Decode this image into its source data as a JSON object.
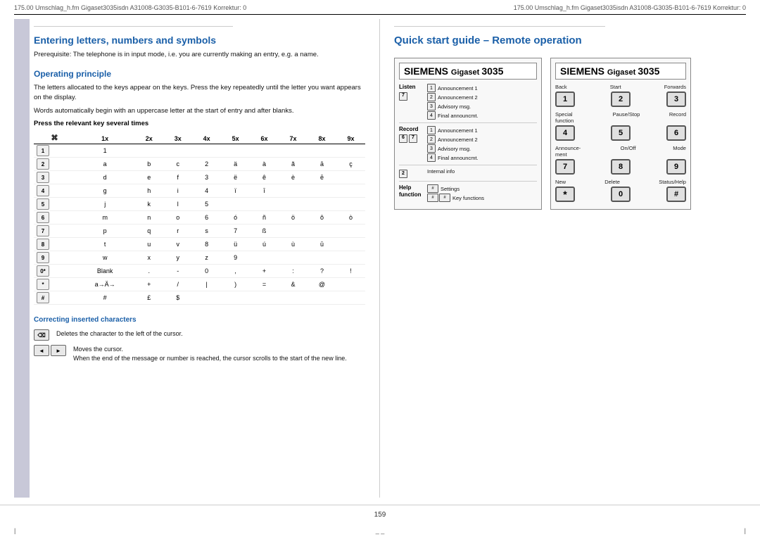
{
  "header": {
    "left_marks": "175.00    Umschlag_h.fm  Gigaset3035isdn  A31008-G3035-B101-6-7619   Korrektur: 0",
    "right_marks": "175.00    Umschlag_h.fm  Gigaset3035isdn  A31008-G3035-B101-6-7619   Korrektur: 0"
  },
  "left_col": {
    "title": "Entering letters, numbers and symbols",
    "intro": "Prerequisite: The telephone is in input mode, i.e. you are currently making an entry, e.g. a name.",
    "subtitle": "Operating principle",
    "body1": "The letters allocated to the keys appear on the keys. Press the key repeatedly until the letter you want appears on the display.",
    "body2": "Words automatically begin with an uppercase letter at the start of entry and after blanks.",
    "press_label": "Press the relevant key several times",
    "table_headers": [
      "",
      "1x",
      "2x",
      "3x",
      "4x",
      "5x",
      "6x",
      "7x",
      "8x",
      "9x"
    ],
    "table_rows": [
      {
        "key": "1",
        "vals": [
          "1",
          "",
          "",
          "",
          "",
          "",
          "",
          "",
          ""
        ]
      },
      {
        "key": "2",
        "vals": [
          "a",
          "b",
          "c",
          "2",
          "ä",
          "à",
          "ã",
          "ā",
          "ç"
        ]
      },
      {
        "key": "3",
        "vals": [
          "d",
          "e",
          "f",
          "3",
          "ë",
          "ê",
          "è",
          "ē",
          ""
        ]
      },
      {
        "key": "4",
        "vals": [
          "g",
          "h",
          "i",
          "4",
          "ï",
          "ī",
          "",
          "",
          ""
        ]
      },
      {
        "key": "5",
        "vals": [
          "j",
          "k",
          "l",
          "5",
          "",
          "",
          "",
          "",
          ""
        ]
      },
      {
        "key": "6",
        "vals": [
          "m",
          "n",
          "o",
          "6",
          "ó",
          "ñ",
          "ö",
          "ô",
          "ò"
        ]
      },
      {
        "key": "7",
        "vals": [
          "p",
          "q",
          "r",
          "s",
          "7",
          "ß",
          "",
          "",
          ""
        ]
      },
      {
        "key": "8",
        "vals": [
          "t",
          "u",
          "v",
          "8",
          "ü",
          "ú",
          "ù",
          "ū",
          ""
        ]
      },
      {
        "key": "9",
        "vals": [
          "w",
          "x",
          "y",
          "z",
          "9",
          "",
          "",
          "",
          ""
        ]
      },
      {
        "key": "0*",
        "vals": [
          "Blank",
          ".",
          "-",
          "0",
          ",",
          "+",
          ":",
          "?",
          "!"
        ]
      },
      {
        "key": "*",
        "vals": [
          "a→Ä→",
          "+",
          "/",
          "|",
          ")",
          "=",
          "&",
          "@",
          ""
        ]
      },
      {
        "key": "#",
        "vals": [
          "#",
          "£",
          "$",
          "",
          "",
          "",
          "",
          "",
          ""
        ]
      }
    ],
    "correcting_title": "Correcting inserted characters",
    "corr_items": [
      {
        "key": "⌫",
        "desc": "Deletes the character to the left of the cursor."
      },
      {
        "keys": [
          "◄",
          "►"
        ],
        "desc": "Moves the cursor.\nWhen the end of the message or number is reached, the cursor scrolls to the start of the new line."
      }
    ]
  },
  "right_col": {
    "title": "Quick start guide – Remote operation",
    "left_phone": {
      "brand": "SIEMENS Gigaset",
      "model": "3035",
      "sections": [
        {
          "label": "Listen",
          "side_num": "7",
          "items": [
            {
              "num": "1",
              "text": "Announcement 1"
            },
            {
              "num": "2",
              "text": "Announcement 2"
            },
            {
              "num": "3",
              "text": "Advisory msg."
            },
            {
              "num": "4",
              "text": "Final announcmt."
            }
          ]
        },
        {
          "label": "Record",
          "side_nums": "6 7",
          "items": [
            {
              "num": "1",
              "text": "Announcement 1"
            },
            {
              "num": "2",
              "text": "Announcement 2"
            },
            {
              "num": "3",
              "text": "Advisory msg."
            },
            {
              "num": "4",
              "text": "Final announcmt."
            }
          ]
        },
        {
          "label": "",
          "side_nums": "2",
          "items": [
            {
              "num": "",
              "text": "Internal info"
            }
          ]
        },
        {
          "label": "Help function",
          "items_special": [
            {
              "icon": "##",
              "text": "Settings"
            },
            {
              "icon": "## ##",
              "text": "Key functions"
            }
          ]
        }
      ]
    },
    "right_phone": {
      "brand": "SIEMENS Gigaset",
      "model": "3035",
      "rows": [
        {
          "labels": [
            "Back",
            "Start",
            "Forwards"
          ],
          "keys": [
            "1",
            "2",
            "3"
          ]
        },
        {
          "labels": [
            "Special function",
            "Pause/Stop",
            "Record"
          ],
          "keys": [
            "4",
            "5",
            "6"
          ]
        },
        {
          "labels": [
            "Announcement",
            "On/Off",
            "Mode"
          ],
          "keys": [
            "7",
            "8",
            "9"
          ]
        },
        {
          "labels": [
            "New",
            "Delete",
            "Status/Help"
          ],
          "keys": [
            "*",
            "0",
            "#"
          ]
        }
      ]
    }
  },
  "footer": {
    "page_number": "159"
  }
}
